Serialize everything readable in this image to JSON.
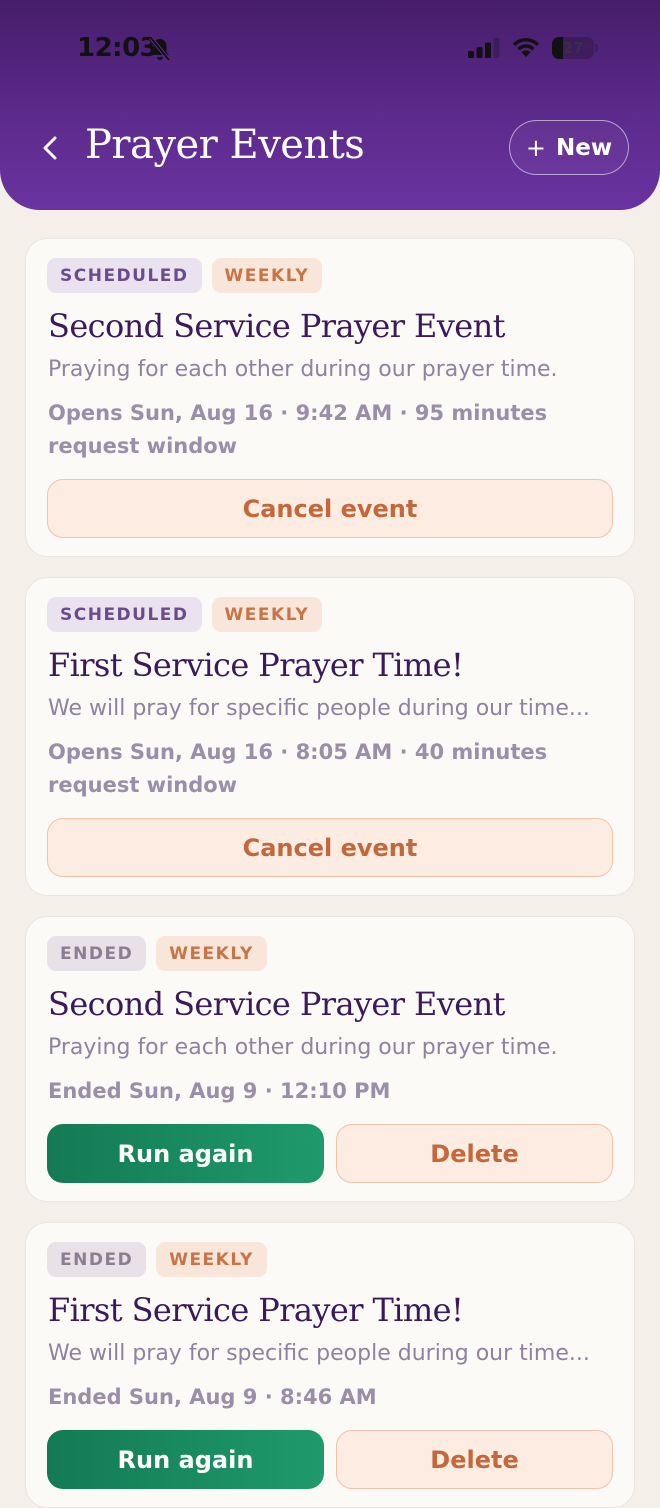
{
  "status_bar": {
    "time": "12:03",
    "battery": "27",
    "battery_level": 0.27
  },
  "header": {
    "title": "Prayer Events",
    "new_label": "New"
  },
  "events": [
    {
      "status": "SCHEDULED",
      "recurrence": "WEEKLY",
      "title": "Second Service Prayer Event",
      "description": "Praying for each other during our prayer time.",
      "meta": "Opens Sun, Aug 16 · 9:42 AM · 95 minutes request window",
      "primary_action": "Cancel event"
    },
    {
      "status": "SCHEDULED",
      "recurrence": "WEEKLY",
      "title": "First Service Prayer Time!",
      "description": "We will pray for specific people during our time...",
      "meta": "Opens Sun, Aug 16 · 8:05 AM · 40 minutes request window",
      "primary_action": "Cancel event"
    },
    {
      "status": "ENDED",
      "recurrence": "WEEKLY",
      "title": "Second Service Prayer Event",
      "description": "Praying for each other during our prayer time.",
      "meta": "Ended Sun, Aug 9 · 12:10 PM",
      "primary_action": "Run again",
      "secondary_action": "Delete"
    },
    {
      "status": "ENDED",
      "recurrence": "WEEKLY",
      "title": "First Service Prayer Time!",
      "description": "We will pray for specific people during our time...",
      "meta": "Ended Sun, Aug 9 · 8:46 AM",
      "primary_action": "Run again",
      "secondary_action": "Delete"
    }
  ],
  "colors": {
    "header_gradient_top": "#461d6a",
    "header_gradient_bottom": "#6a33a0",
    "title_purple": "#3a1a5c",
    "accent_orange": "#c4673a",
    "run_green": "#137a55"
  }
}
